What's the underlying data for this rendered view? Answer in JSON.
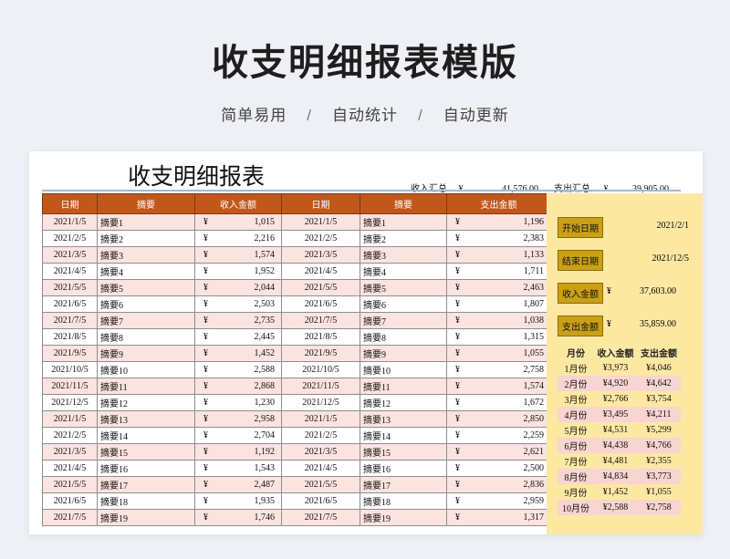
{
  "hero": {
    "title": "收支明细报表模版",
    "tags": [
      "简单易用",
      "自动统计",
      "自动更新"
    ],
    "separator": "/"
  },
  "sheet": {
    "title": "收支明细报表",
    "summary": {
      "income_label": "收入汇总",
      "income_currency": "¥",
      "income_total": "41,576.00",
      "expense_label": "支出汇总",
      "expense_currency": "¥",
      "expense_total": "39,905.00"
    },
    "columns": [
      "日期",
      "摘要",
      "收入金额",
      "日期",
      "摘要",
      "支出金额"
    ],
    "currency": "¥",
    "rows": [
      {
        "income_date": "2021/1/5",
        "income_memo": "摘要1",
        "income_amount": "1,015",
        "expense_date": "2021/1/5",
        "expense_memo": "摘要1",
        "expense_amount": "1,196"
      },
      {
        "income_date": "2021/2/5",
        "income_memo": "摘要2",
        "income_amount": "2,216",
        "expense_date": "2021/2/5",
        "expense_memo": "摘要2",
        "expense_amount": "2,383"
      },
      {
        "income_date": "2021/3/5",
        "income_memo": "摘要3",
        "income_amount": "1,574",
        "expense_date": "2021/3/5",
        "expense_memo": "摘要3",
        "expense_amount": "1,133"
      },
      {
        "income_date": "2021/4/5",
        "income_memo": "摘要4",
        "income_amount": "1,952",
        "expense_date": "2021/4/5",
        "expense_memo": "摘要4",
        "expense_amount": "1,711"
      },
      {
        "income_date": "2021/5/5",
        "income_memo": "摘要5",
        "income_amount": "2,044",
        "expense_date": "2021/5/5",
        "expense_memo": "摘要5",
        "expense_amount": "2,463"
      },
      {
        "income_date": "2021/6/5",
        "income_memo": "摘要6",
        "income_amount": "2,503",
        "expense_date": "2021/6/5",
        "expense_memo": "摘要6",
        "expense_amount": "1,807"
      },
      {
        "income_date": "2021/7/5",
        "income_memo": "摘要7",
        "income_amount": "2,735",
        "expense_date": "2021/7/5",
        "expense_memo": "摘要7",
        "expense_amount": "1,038"
      },
      {
        "income_date": "2021/8/5",
        "income_memo": "摘要8",
        "income_amount": "2,445",
        "expense_date": "2021/8/5",
        "expense_memo": "摘要8",
        "expense_amount": "1,315"
      },
      {
        "income_date": "2021/9/5",
        "income_memo": "摘要9",
        "income_amount": "1,452",
        "expense_date": "2021/9/5",
        "expense_memo": "摘要9",
        "expense_amount": "1,055"
      },
      {
        "income_date": "2021/10/5",
        "income_memo": "摘要10",
        "income_amount": "2,588",
        "expense_date": "2021/10/5",
        "expense_memo": "摘要10",
        "expense_amount": "2,758"
      },
      {
        "income_date": "2021/11/5",
        "income_memo": "摘要11",
        "income_amount": "2,868",
        "expense_date": "2021/11/5",
        "expense_memo": "摘要11",
        "expense_amount": "1,574"
      },
      {
        "income_date": "2021/12/5",
        "income_memo": "摘要12",
        "income_amount": "1,230",
        "expense_date": "2021/12/5",
        "expense_memo": "摘要12",
        "expense_amount": "1,672"
      },
      {
        "income_date": "2021/1/5",
        "income_memo": "摘要13",
        "income_amount": "2,958",
        "expense_date": "2021/1/5",
        "expense_memo": "摘要13",
        "expense_amount": "2,850"
      },
      {
        "income_date": "2021/2/5",
        "income_memo": "摘要14",
        "income_amount": "2,704",
        "expense_date": "2021/2/5",
        "expense_memo": "摘要14",
        "expense_amount": "2,259"
      },
      {
        "income_date": "2021/3/5",
        "income_memo": "摘要15",
        "income_amount": "1,192",
        "expense_date": "2021/3/5",
        "expense_memo": "摘要15",
        "expense_amount": "2,621"
      },
      {
        "income_date": "2021/4/5",
        "income_memo": "摘要16",
        "income_amount": "1,543",
        "expense_date": "2021/4/5",
        "expense_memo": "摘要16",
        "expense_amount": "2,500"
      },
      {
        "income_date": "2021/5/5",
        "income_memo": "摘要17",
        "income_amount": "2,487",
        "expense_date": "2021/5/5",
        "expense_memo": "摘要17",
        "expense_amount": "2,836"
      },
      {
        "income_date": "2021/6/5",
        "income_memo": "摘要18",
        "income_amount": "1,935",
        "expense_date": "2021/6/5",
        "expense_memo": "摘要18",
        "expense_amount": "2,959"
      },
      {
        "income_date": "2021/7/5",
        "income_memo": "摘要19",
        "income_amount": "1,746",
        "expense_date": "2021/7/5",
        "expense_memo": "摘要19",
        "expense_amount": "1,317"
      }
    ]
  },
  "side": {
    "start_label": "开始日期",
    "start_value": "2021/2/1",
    "end_label": "结束日期",
    "end_value": "2021/12/5",
    "income_label": "收入金额",
    "income_currency": "¥",
    "income_value": "37,603.00",
    "expense_label": "支出金额",
    "expense_currency": "¥",
    "expense_value": "35,859.00",
    "monthly_columns": [
      "月份",
      "收入金额",
      "支出金额"
    ],
    "monthly": [
      {
        "month": "1月份",
        "income": "¥3,973",
        "expense": "¥4,046"
      },
      {
        "month": "2月份",
        "income": "¥4,920",
        "expense": "¥4,642"
      },
      {
        "month": "3月份",
        "income": "¥2,766",
        "expense": "¥3,754"
      },
      {
        "month": "4月份",
        "income": "¥3,495",
        "expense": "¥4,211"
      },
      {
        "month": "5月份",
        "income": "¥4,531",
        "expense": "¥5,299"
      },
      {
        "month": "6月份",
        "income": "¥4,438",
        "expense": "¥4,766"
      },
      {
        "month": "7月份",
        "income": "¥4,481",
        "expense": "¥2,355"
      },
      {
        "month": "8月份",
        "income": "¥4,834",
        "expense": "¥3,773"
      },
      {
        "month": "9月份",
        "income": "¥1,452",
        "expense": "¥1,055"
      },
      {
        "month": "10月份",
        "income": "¥2,588",
        "expense": "¥2,758"
      }
    ]
  }
}
